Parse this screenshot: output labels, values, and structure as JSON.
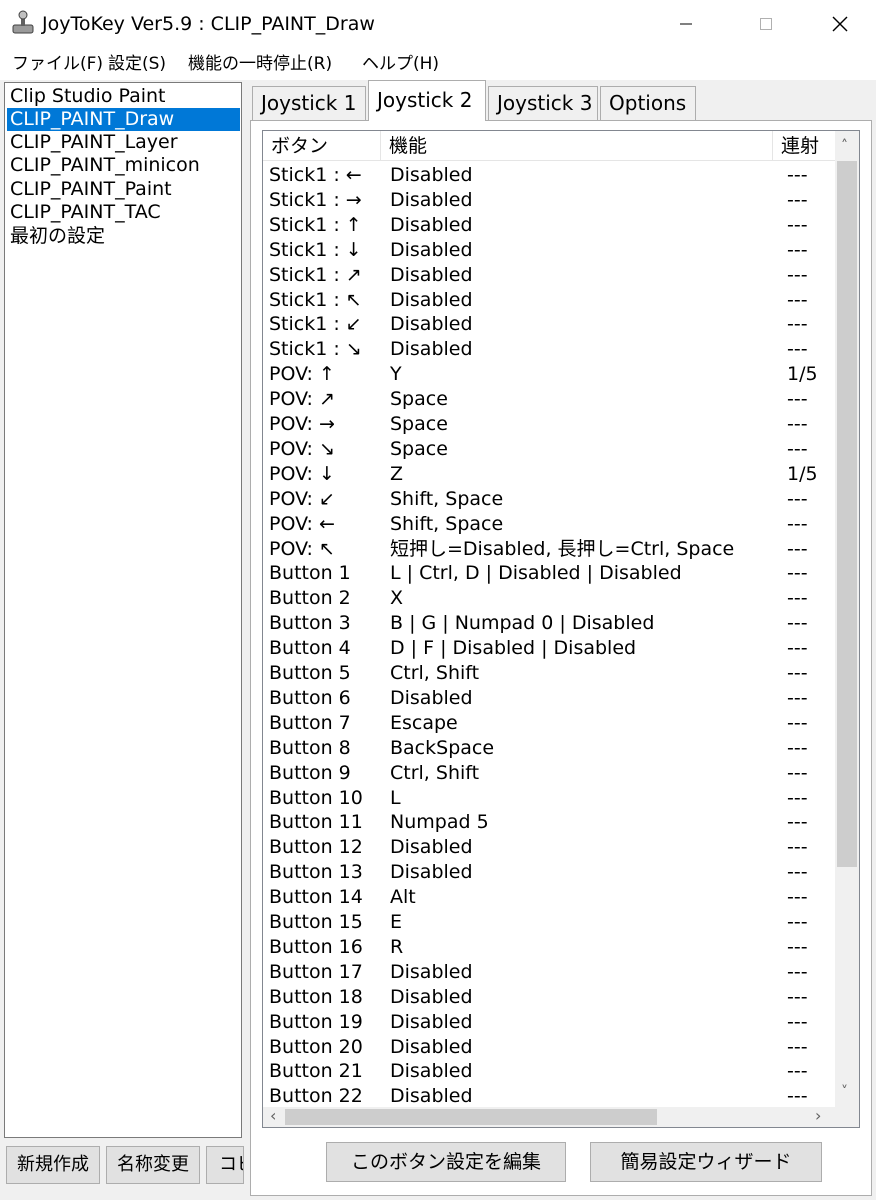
{
  "window": {
    "title": "JoyToKey Ver5.9 : CLIP_PAINT_Draw",
    "minimize_glyph": "—",
    "maximize_glyph": "☐",
    "close_glyph": "✕"
  },
  "menu": [
    "ファイル(F)",
    "設定(S)",
    "機能の一時停止(R)",
    "ヘルプ(H)"
  ],
  "profiles": {
    "items": [
      "Clip Studio Paint",
      "CLIP_PAINT_Draw",
      "CLIP_PAINT_Layer",
      "CLIP_PAINT_minicon",
      "CLIP_PAINT_Paint",
      "CLIP_PAINT_TAC",
      "最初の設定"
    ],
    "selected_index": 1,
    "buttons": [
      "新規作成",
      "名称変更",
      "コピ"
    ]
  },
  "tabs": [
    "Joystick 1",
    "Joystick 2",
    "Joystick 3",
    "Options"
  ],
  "active_tab_index": 1,
  "grid": {
    "columns": [
      "ボタン",
      "機能",
      "連射"
    ],
    "rows": [
      {
        "button": "Stick1 : ←",
        "function": "Disabled",
        "repeat": "---"
      },
      {
        "button": "Stick1 : →",
        "function": "Disabled",
        "repeat": "---"
      },
      {
        "button": "Stick1 : ↑",
        "function": "Disabled",
        "repeat": "---"
      },
      {
        "button": "Stick1 : ↓",
        "function": "Disabled",
        "repeat": "---"
      },
      {
        "button": "Stick1 : ↗",
        "function": "Disabled",
        "repeat": "---"
      },
      {
        "button": "Stick1 : ↖",
        "function": "Disabled",
        "repeat": "---"
      },
      {
        "button": "Stick1 : ↙",
        "function": "Disabled",
        "repeat": "---"
      },
      {
        "button": "Stick1 : ↘",
        "function": "Disabled",
        "repeat": "---"
      },
      {
        "button": "POV: ↑",
        "function": "Y",
        "repeat": "1/5"
      },
      {
        "button": "POV: ↗",
        "function": "Space",
        "repeat": "---"
      },
      {
        "button": "POV: →",
        "function": "Space",
        "repeat": "---"
      },
      {
        "button": "POV: ↘",
        "function": "Space",
        "repeat": "---"
      },
      {
        "button": "POV: ↓",
        "function": "Z",
        "repeat": "1/5"
      },
      {
        "button": "POV: ↙",
        "function": "Shift, Space",
        "repeat": "---"
      },
      {
        "button": "POV: ←",
        "function": "Shift, Space",
        "repeat": "---"
      },
      {
        "button": "POV: ↖",
        "function": "短押し=Disabled, 長押し=Ctrl, Space",
        "repeat": "---"
      },
      {
        "button": "Button 1",
        "function": "L | Ctrl, D | Disabled | Disabled",
        "repeat": "---"
      },
      {
        "button": "Button 2",
        "function": "X",
        "repeat": "---"
      },
      {
        "button": "Button 3",
        "function": "B | G | Numpad 0 | Disabled",
        "repeat": "---"
      },
      {
        "button": "Button 4",
        "function": "D | F | Disabled | Disabled",
        "repeat": "---"
      },
      {
        "button": "Button 5",
        "function": "Ctrl, Shift",
        "repeat": "---"
      },
      {
        "button": "Button 6",
        "function": "Disabled",
        "repeat": "---"
      },
      {
        "button": "Button 7",
        "function": "Escape",
        "repeat": "---"
      },
      {
        "button": "Button 8",
        "function": "BackSpace",
        "repeat": "---"
      },
      {
        "button": "Button 9",
        "function": "Ctrl, Shift",
        "repeat": "---"
      },
      {
        "button": "Button 10",
        "function": "L",
        "repeat": "---"
      },
      {
        "button": "Button 11",
        "function": "Numpad 5",
        "repeat": "---"
      },
      {
        "button": "Button 12",
        "function": "Disabled",
        "repeat": "---"
      },
      {
        "button": "Button 13",
        "function": "Disabled",
        "repeat": "---"
      },
      {
        "button": "Button 14",
        "function": "Alt",
        "repeat": "---"
      },
      {
        "button": "Button 15",
        "function": "E",
        "repeat": "---"
      },
      {
        "button": "Button 16",
        "function": "R",
        "repeat": "---"
      },
      {
        "button": "Button 17",
        "function": "Disabled",
        "repeat": "---"
      },
      {
        "button": "Button 18",
        "function": "Disabled",
        "repeat": "---"
      },
      {
        "button": "Button 19",
        "function": "Disabled",
        "repeat": "---"
      },
      {
        "button": "Button 20",
        "function": "Disabled",
        "repeat": "---"
      },
      {
        "button": "Button 21",
        "function": "Disabled",
        "repeat": "---"
      },
      {
        "button": "Button 22",
        "function": "Disabled",
        "repeat": "---"
      }
    ]
  },
  "scroll": {
    "up": "˄",
    "down": "˅",
    "left": "‹",
    "right": "›"
  },
  "actions": {
    "edit_button": "このボタン設定を編集",
    "wizard_button": "簡易設定ウィザード"
  },
  "colors": {
    "selection": "#0078d7",
    "window_bg": "#f0f0f0"
  }
}
